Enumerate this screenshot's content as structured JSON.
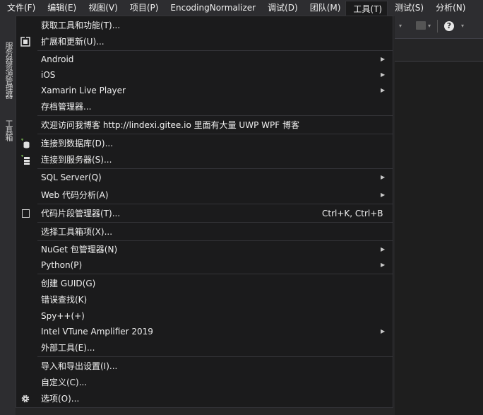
{
  "menubar": [
    {
      "label": "文件(F)",
      "active": false
    },
    {
      "label": "编辑(E)",
      "active": false
    },
    {
      "label": "视图(V)",
      "active": false
    },
    {
      "label": "项目(P)",
      "active": false
    },
    {
      "label": "EncodingNormalizer",
      "active": false
    },
    {
      "label": "调试(D)",
      "active": false
    },
    {
      "label": "团队(M)",
      "active": false
    },
    {
      "label": "工具(T)",
      "active": true
    },
    {
      "label": "测试(S)",
      "active": false
    },
    {
      "label": "分析(N)",
      "active": false
    }
  ],
  "side_tabs": {
    "server_explorer": "服务器资源管理器",
    "toolbox": "工具箱"
  },
  "tools_menu": {
    "get_tools": "获取工具和功能(T)...",
    "extensions": "扩展和更新(U)...",
    "android": "Android",
    "ios": "iOS",
    "xamarin": "Xamarin Live Player",
    "archive": "存档管理器...",
    "blog": "欢迎访问我博客 http://lindexi.gitee.io 里面有大量 UWP WPF 博客",
    "connect_db": "连接到数据库(D)...",
    "connect_server": "连接到服务器(S)...",
    "sql_server": "SQL Server(Q)",
    "web_analysis": "Web 代码分析(A)",
    "snippets": "代码片段管理器(T)...",
    "snippets_shortcut": "Ctrl+K, Ctrl+B",
    "choose_toolbox": "选择工具箱项(X)...",
    "nuget": "NuGet 包管理器(N)",
    "python": "Python(P)",
    "create_guid": "创建 GUID(G)",
    "error_lookup": "错误查找(K)",
    "spy": "Spy++(+)",
    "vtune": "Intel VTune Amplifier 2019",
    "external_tools": "外部工具(E)...",
    "import_export": "导入和导出设置(I)...",
    "customize": "自定义(C)...",
    "options": "选项(O)..."
  },
  "submenu_arrow": "▶",
  "colors": {
    "menu_bg": "#1b1b1c",
    "chrome_bg": "#2d2d30",
    "text": "#f1f1f1",
    "separator": "#333337"
  }
}
